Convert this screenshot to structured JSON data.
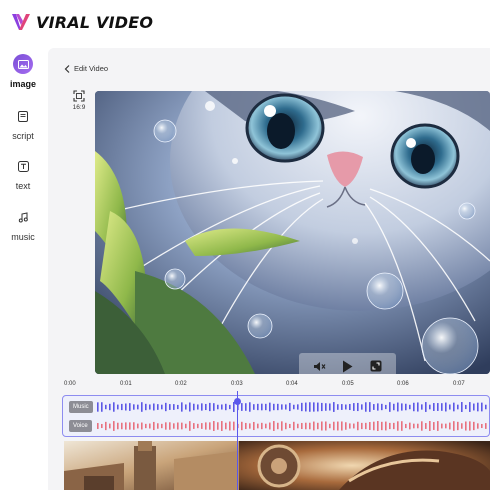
{
  "app": {
    "title": "VIRAL VIDEO",
    "brand_color": "#7b3fe4"
  },
  "sidebar": {
    "items": [
      {
        "label": "image",
        "icon": "image-icon",
        "active": true
      },
      {
        "label": "script",
        "icon": "document-icon",
        "active": false
      },
      {
        "label": "text",
        "icon": "text-icon",
        "active": false
      },
      {
        "label": "music",
        "icon": "music-note-icon",
        "active": false
      }
    ]
  },
  "editor": {
    "back_label": "Edit Video",
    "aspect_ratio": "16:9",
    "preview_image": "anime-style kitten with water bubbles and leaves",
    "controls": {
      "mute": "speaker-mute-icon",
      "play": "play-icon",
      "fullscreen": "fullscreen-icon"
    }
  },
  "timeline": {
    "ticks": [
      "0:00",
      "0:01",
      "0:02",
      "0:03",
      "0:04",
      "0:05",
      "0:06",
      "0:07"
    ],
    "playhead_time": "0:03",
    "tracks": [
      {
        "label": "Music",
        "color": "#5b57e6"
      },
      {
        "label": "Voice",
        "color": "#e8707e"
      }
    ],
    "highlight_color": "#5a58ec"
  }
}
